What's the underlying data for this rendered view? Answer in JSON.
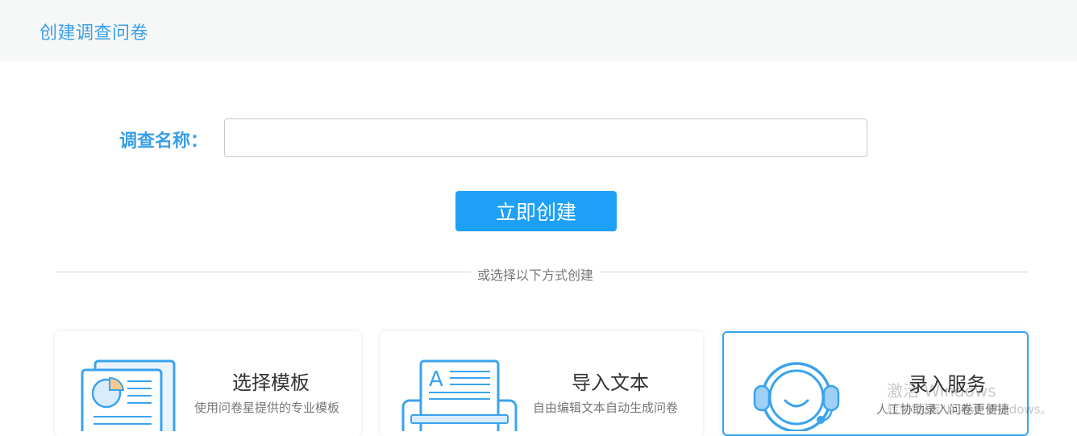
{
  "header": {
    "title": "创建调查问卷"
  },
  "form": {
    "name_label": "调查名称：",
    "name_value": "",
    "name_placeholder": "",
    "create_button": "立即创建"
  },
  "divider_text": "或选择以下方式创建",
  "cards": [
    {
      "title": "选择模板",
      "desc": "使用问卷星提供的专业模板",
      "icon": "template-icon"
    },
    {
      "title": "导入文本",
      "desc": "自由编辑文本自动生成问卷",
      "icon": "import-text-icon"
    },
    {
      "title": "录入服务",
      "desc": "人工协助录入问卷更便捷",
      "icon": "support-agent-icon"
    }
  ],
  "watermark": {
    "line1": "激活 Windows",
    "line2": "转到\"设置\"以激活 Windows。"
  },
  "colors": {
    "accent": "#1ea0f7",
    "title_blue": "#3a9ee5",
    "topbar_bg": "#f6f8f8"
  }
}
